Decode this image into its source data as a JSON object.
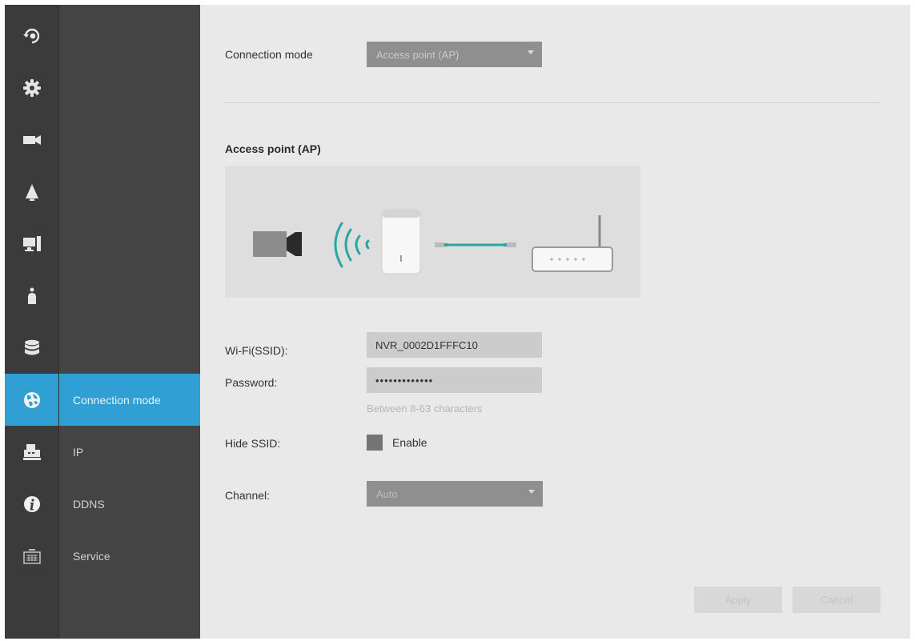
{
  "rail": [
    {
      "icon": "camera-rotate-icon"
    },
    {
      "icon": "gear-icon"
    },
    {
      "icon": "video-camera-icon"
    },
    {
      "icon": "alarm-bell-icon"
    },
    {
      "icon": "computer-monitor-icon"
    },
    {
      "icon": "user-icon"
    },
    {
      "icon": "database-icon"
    },
    {
      "icon": "globe-network-icon",
      "active": true
    },
    {
      "icon": "printer-icon"
    },
    {
      "icon": "info-icon"
    },
    {
      "icon": "keyboard-icon"
    }
  ],
  "subnav": {
    "items": [
      {
        "label": "Connection mode",
        "active": true
      },
      {
        "label": "IP"
      },
      {
        "label": "DDNS"
      },
      {
        "label": "Service"
      }
    ]
  },
  "main": {
    "connection_mode_label": "Connection mode",
    "connection_mode_value": "Access point (AP)",
    "section_title": "Access point (AP)",
    "diagram_icons": [
      "camera-icon",
      "wifi-signal-icon",
      "access-point-icon",
      "ethernet-cable-icon",
      "router-icon"
    ],
    "wifi_label": "Wi-Fi(SSID):",
    "wifi_value": "NVR_0002D1FFFC10",
    "password_label": "Password:",
    "password_value": "•••••••••••••",
    "password_hint": "Between 8-63 characters",
    "hide_ssid_label": "Hide SSID:",
    "enable_label": "Enable",
    "channel_label": "Channel:",
    "channel_value": "Auto",
    "apply_label": "Apply",
    "cancel_label": "Cancel"
  },
  "colors": {
    "accent": "#2f9fd4",
    "rail_bg": "#3b3b3b",
    "subnav_bg": "#444444",
    "signal": "#2aa7a0"
  }
}
